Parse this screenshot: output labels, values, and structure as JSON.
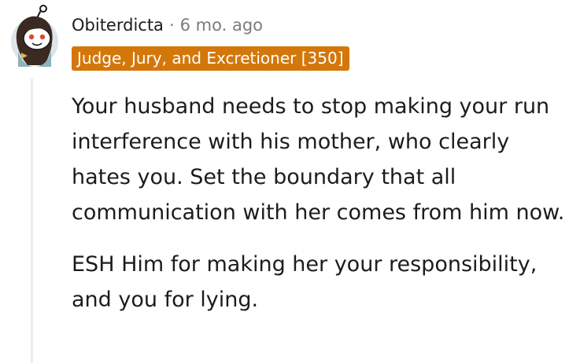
{
  "comment": {
    "username": "Obiterdicta",
    "separator": "·",
    "age": "6 mo. ago",
    "flair": "Judge, Jury, and Excretioner [350]",
    "paragraphs": [
      "Your husband needs to stop making your run interference with his mother, who clearly hates you. Set the boundary that all communication with her comes from him now.",
      "ESH Him for making her your responsibility, and you for lying."
    ]
  },
  "colors": {
    "flair_background": "#d4770a",
    "flair_text": "#ffffff",
    "username": "#1c1c1c",
    "meta_muted": "#7c7c7c",
    "body_text": "#1c1c1c",
    "thread_line": "#ececec"
  },
  "icons": {
    "avatar": "snoo-avatar-icon"
  }
}
